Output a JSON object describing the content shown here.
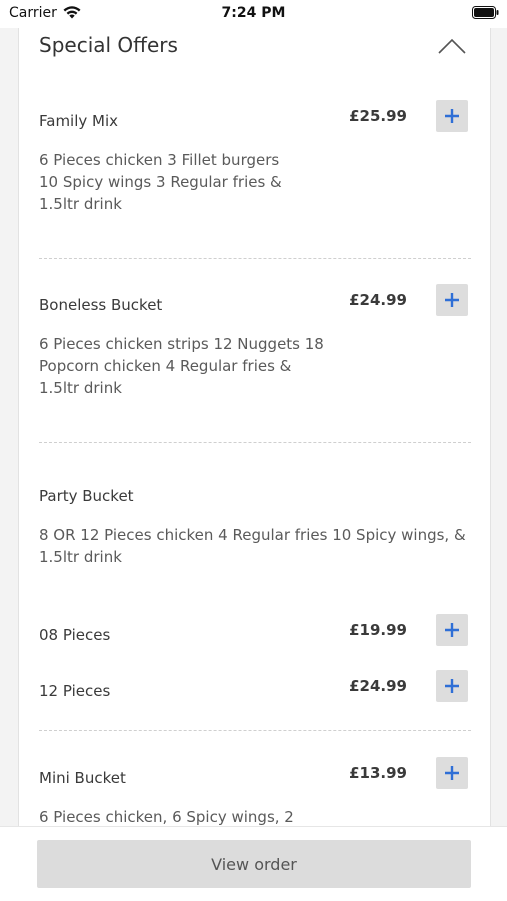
{
  "status_bar": {
    "carrier": "Carrier",
    "time": "7:24 PM"
  },
  "section": {
    "title": "Special Offers",
    "collapse_icon": "chevron-up-icon"
  },
  "items": [
    {
      "name": "Family Mix",
      "price": "£25.99",
      "description": "6 Pieces chicken 3 Fillet burgers 10 Spicy wings 3 Regular fries & 1.5ltr drink"
    },
    {
      "name": "Boneless Bucket",
      "price": "£24.99",
      "description": "6 Pieces chicken strips 12 Nuggets 18 Popcorn chicken 4 Regular fries & 1.5ltr drink"
    },
    {
      "name": "Party Bucket",
      "description": "8 OR 12 Pieces chicken 4 Regular fries 10 Spicy wings, & 1.5ltr drink",
      "options": [
        {
          "name": "08 Pieces",
          "price": "£19.99"
        },
        {
          "name": "12 Pieces",
          "price": "£24.99"
        }
      ]
    },
    {
      "name": "Mini Bucket",
      "price": "£13.99",
      "description": "6 Pieces chicken, 6 Spicy wings, 2"
    }
  ],
  "add_icon": "plus-icon",
  "footer": {
    "view_order_label": "View order"
  },
  "colors": {
    "accent_plus": "#2f6fd6",
    "button_bg": "#dddddd",
    "page_bg": "#f3f3f3"
  }
}
